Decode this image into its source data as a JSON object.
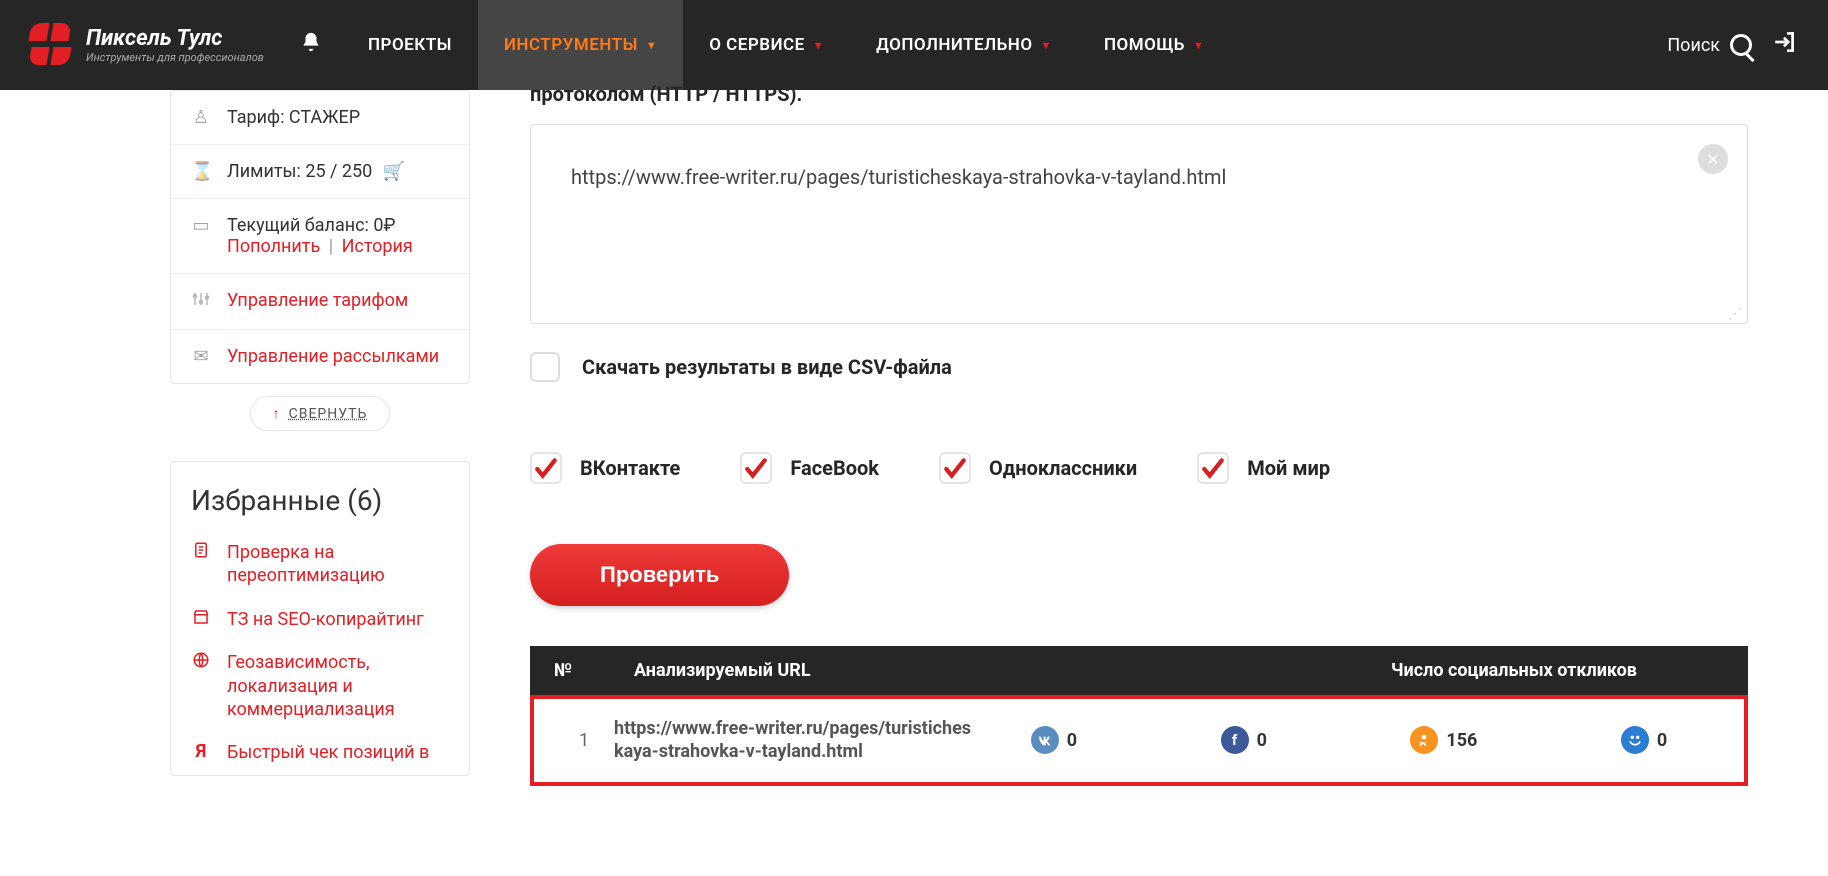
{
  "header": {
    "brand_title": "Пиксель Тулс",
    "brand_sub": "Инструменты для профессионалов",
    "nav": [
      {
        "label": "ПРОЕКТЫ",
        "caret": false
      },
      {
        "label": "ИНСТРУМЕНТЫ",
        "caret": true,
        "active": true
      },
      {
        "label": "О СЕРВИСЕ",
        "caret": true
      },
      {
        "label": "ДОПОЛНИТЕЛЬНО",
        "caret": true
      },
      {
        "label": "ПОМОЩЬ",
        "caret": true
      }
    ],
    "search": "Поиск"
  },
  "sidebar": {
    "tariff_label": "Тариф: СТАЖЕР",
    "limits_label": "Лимиты: 25 / 250",
    "balance_label": "Текущий баланс: 0₽",
    "topup": "Пополнить",
    "history": "История",
    "manage_tariff": "Управление тарифом",
    "manage_mailings": "Управление рассылками",
    "collapse": "СВЕРНУТЬ",
    "fav_title": "Избранные (6)",
    "favorites": [
      "Проверка на переоптимизацию",
      "ТЗ на SEO-копирайтинг",
      "Геозависимость, локализация и коммерциализация",
      "Быстрый чек позиций в"
    ]
  },
  "main": {
    "instruction_tail": "протоколом (HTTP / HTTPS).",
    "textarea_value": "https://www.free-writer.ru/pages/turisticheskaya-strahovka-v-tayland.html",
    "csv_label": "Скачать результаты в виде CSV-файла",
    "networks": [
      "ВКонтакте",
      "FaceBook",
      "Одноклассники",
      "Мой мир"
    ],
    "check_btn": "Проверить",
    "table": {
      "col_num": "№",
      "col_url": "Анализируемый URL",
      "col_soc": "Число социальных откликов",
      "row": {
        "num": "1",
        "url": "https://www.free-writer.ru/pages/turisticheskaya-strahovka-v-tayland.html",
        "vk": "0",
        "fb": "0",
        "ok": "156",
        "mm": "0"
      }
    }
  }
}
